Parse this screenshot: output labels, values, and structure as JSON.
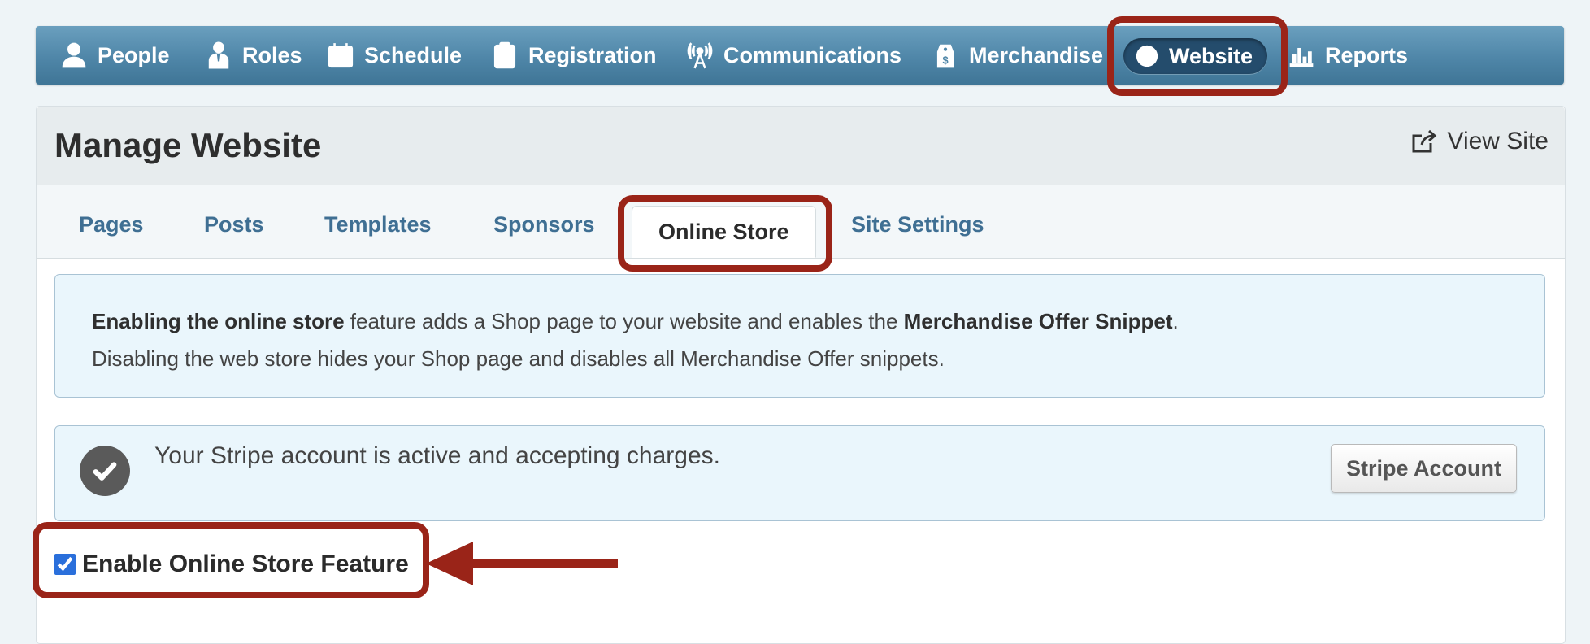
{
  "nav": {
    "items": [
      {
        "label": "People",
        "icon": "people-icon"
      },
      {
        "label": "Roles",
        "icon": "roles-icon"
      },
      {
        "label": "Schedule",
        "icon": "calendar-icon"
      },
      {
        "label": "Registration",
        "icon": "clipboard-check-icon"
      },
      {
        "label": "Communications",
        "icon": "antenna-icon"
      },
      {
        "label": "Merchandise",
        "icon": "price-tag-icon"
      },
      {
        "label": "Website",
        "icon": "globe-icon",
        "active": true
      },
      {
        "label": "Reports",
        "icon": "bar-chart-icon"
      }
    ]
  },
  "page": {
    "title": "Manage Website",
    "view_site_label": "View Site"
  },
  "tabs": [
    {
      "label": "Pages"
    },
    {
      "label": "Posts"
    },
    {
      "label": "Templates"
    },
    {
      "label": "Sponsors"
    },
    {
      "label": "Online Store",
      "active": true
    },
    {
      "label": "Site Settings"
    }
  ],
  "info": {
    "bold1": "Enabling the online store",
    "text1": " feature adds a Shop page to your website and enables the ",
    "bold2": "Merchandise Offer Snippet",
    "text2": ".",
    "line2": "Disabling the web store hides your Shop page and disables all Merchandise Offer snippets."
  },
  "stripe": {
    "message": "Your Stripe account is active and accepting charges.",
    "button_label": "Stripe Account",
    "status_icon": "check-circle-icon"
  },
  "enable_store": {
    "label": "Enable Online Store Feature",
    "checked": true
  },
  "annotation_color": "#9a2418",
  "accent_nav": "#4f86a8"
}
